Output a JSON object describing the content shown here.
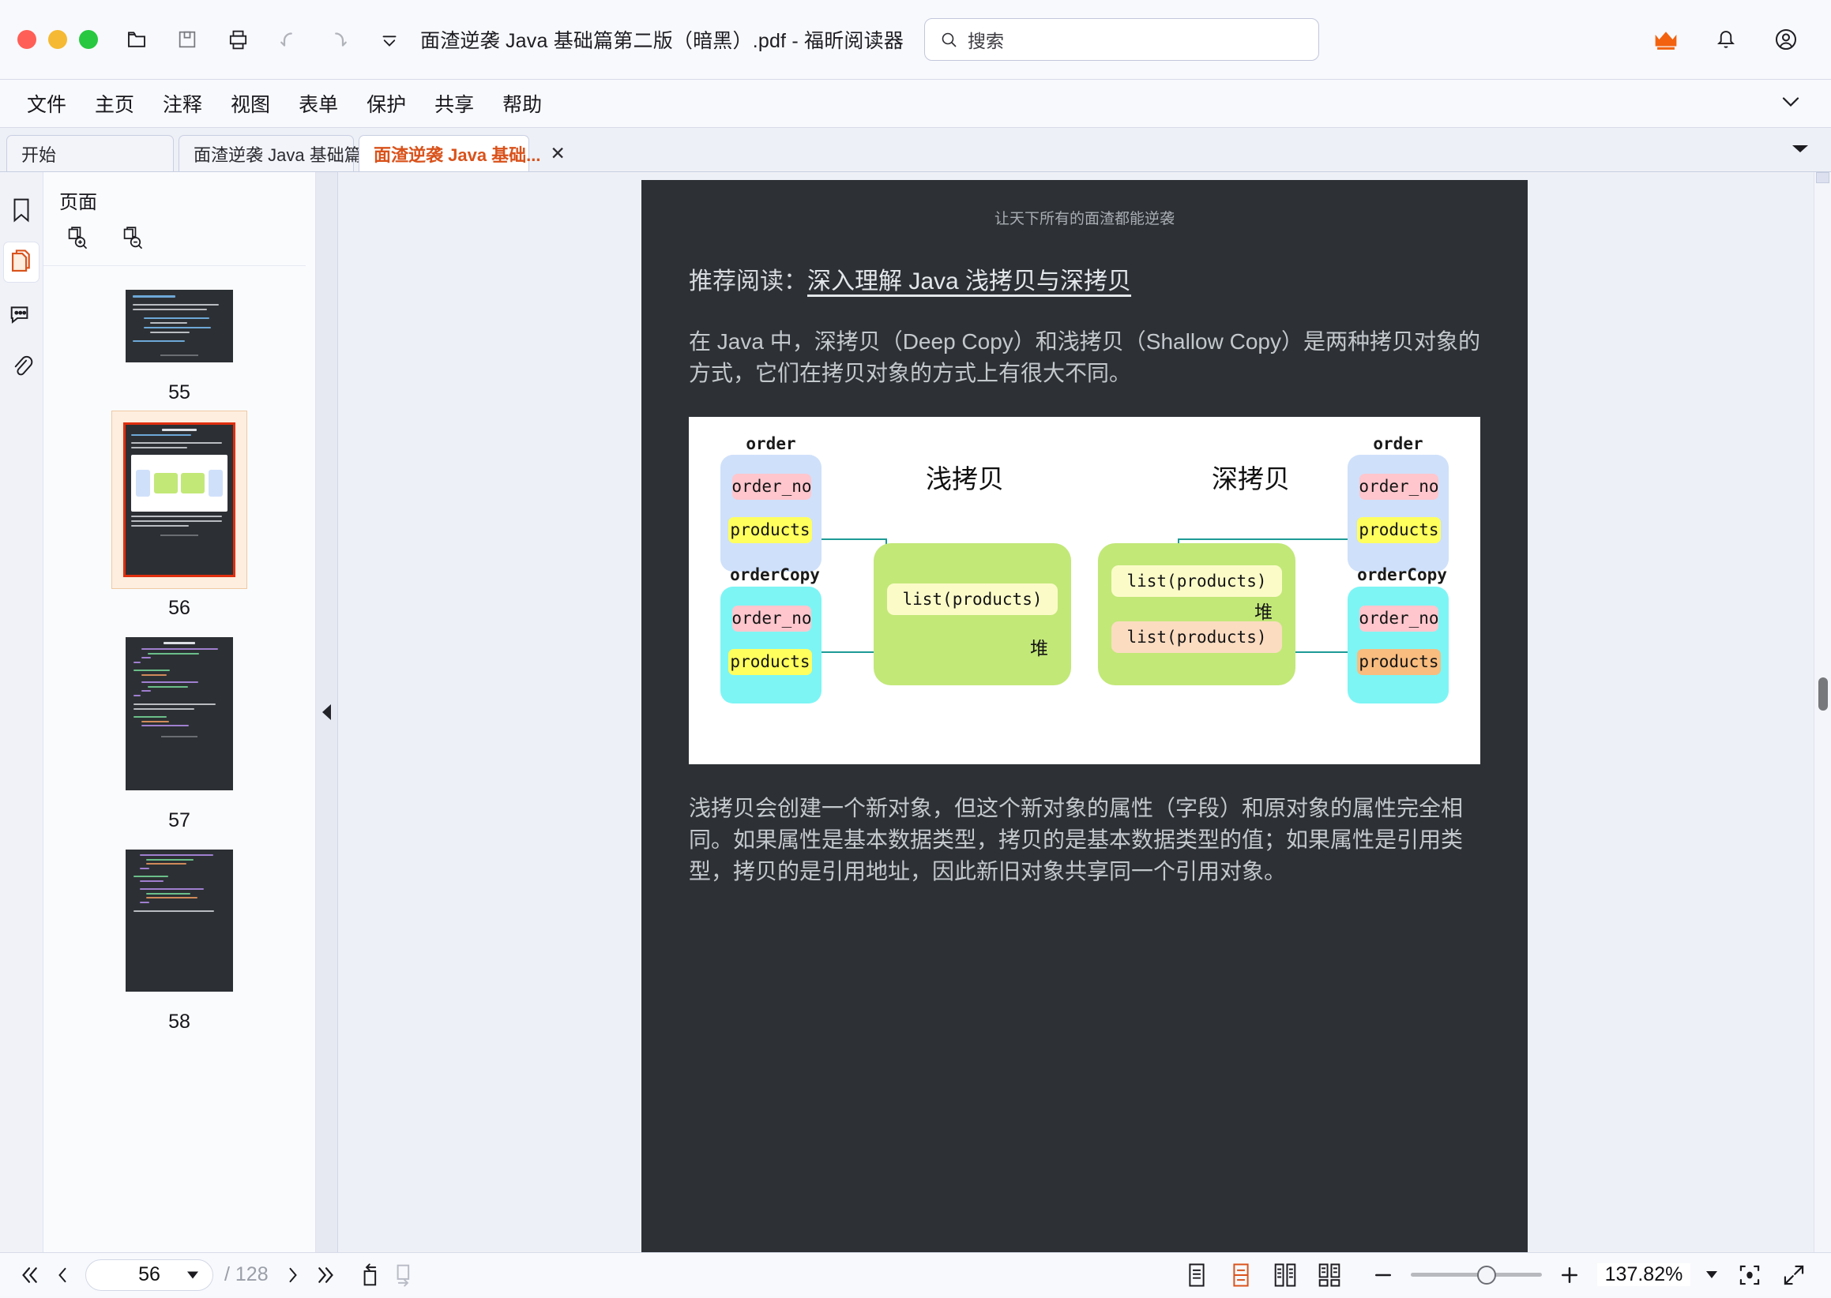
{
  "window": {
    "title": "面渣逆袭 Java 基础篇第二版（暗黑）.pdf - 福昕阅读器",
    "traffic": [
      "close",
      "minimize",
      "maximize"
    ]
  },
  "toolbar": {
    "icons": [
      "open-folder-icon",
      "save-icon",
      "print-icon",
      "undo-icon",
      "redo-icon",
      "customize-toolbar-icon"
    ]
  },
  "search": {
    "placeholder": "搜索",
    "icon": "search-icon"
  },
  "account_bar": {
    "crown": "crown-icon",
    "bell": "bell-icon",
    "avatar": "account-icon",
    "crown_color": "#f2620f"
  },
  "menu": {
    "items": [
      "文件",
      "主页",
      "注释",
      "视图",
      "表单",
      "保护",
      "共享",
      "帮助"
    ],
    "collapse_icon": "chevron-down-icon"
  },
  "tabs": {
    "items": [
      {
        "label": "开始",
        "active": false,
        "closable": false
      },
      {
        "label": "面渣逆袭 Java 基础篇...",
        "active": false,
        "closable": false
      },
      {
        "label": "面渣逆袭 Java 基础...",
        "active": true,
        "closable": true
      }
    ],
    "close_glyph": "✕",
    "overflow_icon": "caret-down-icon",
    "active_color": "#d9521b"
  },
  "rail": {
    "items": [
      {
        "name": "bookmark-icon",
        "active": false
      },
      {
        "name": "pages-icon",
        "active": true
      },
      {
        "name": "comments-icon",
        "active": false
      },
      {
        "name": "attachments-icon",
        "active": false
      }
    ],
    "active_color": "#d9521b"
  },
  "thumbnails_panel": {
    "title": "页面",
    "tools": [
      "zoom-in-thumbnails-icon",
      "zoom-out-thumbnails-icon"
    ],
    "pages": [
      {
        "number": "55",
        "selected": false,
        "kind": "text"
      },
      {
        "number": "56",
        "selected": true,
        "kind": "figure"
      },
      {
        "number": "57",
        "selected": false,
        "kind": "code"
      },
      {
        "number": "58",
        "selected": false,
        "kind": "code"
      }
    ],
    "selected_highlight": "#fdeedf",
    "selected_border": "#e02f0f"
  },
  "collapse_handle": {
    "icon": "collapse-left-triangle-icon"
  },
  "document": {
    "header": "让天下所有的面渣都能逆袭",
    "recommend_prefix": "推荐阅读：",
    "recommend_link": "深入理解 Java 浅拷贝与深拷贝",
    "paragraph_1": "在 Java 中，深拷贝（Deep Copy）和浅拷贝（Shallow Copy）是两种拷贝对象的方式，它们在拷贝对象的方式上有很大不同。",
    "paragraph_2": "浅拷贝会创建一个新对象，但这个新对象的属性（字段）和原对象的属性完全相同。如果属性是基本数据类型，拷贝的是基本数据类型的值；如果属性是引用类型，拷贝的是引用地址，因此新旧对象共享同一个引用对象。",
    "page_bg": "#2d3136"
  },
  "figure": {
    "shallow_title": "浅拷贝",
    "deep_title": "深拷贝",
    "heap_label": "堆",
    "shallow": {
      "order_title": "order",
      "ordercopy_title": "orderCopy",
      "order_fields": [
        "order_no",
        "products"
      ],
      "ordercopy_fields": [
        "order_no",
        "products"
      ],
      "heap_items": [
        "list(products)"
      ]
    },
    "deep": {
      "order_title": "order",
      "ordercopy_title": "orderCopy",
      "order_fields": [
        "order_no",
        "products"
      ],
      "ordercopy_fields": [
        "order_no",
        "products"
      ],
      "heap_items": [
        "list(products)",
        "list(products)"
      ]
    },
    "colors": {
      "order_box": "#cfe0fa",
      "ordercopy_box": "#7df5f5",
      "field_pink": "#ffc6cd",
      "field_yellow": "#ffff5e",
      "field_orange": "#f8bd7f",
      "heap": "#c2e878",
      "heap_item_pale": "#fbfbc8",
      "heap_item_peach": "#fbdcc1",
      "arrow": "#1e9a96"
    }
  },
  "bottombar": {
    "first_page_icon": "double-chevron-left-icon",
    "prev_page_icon": "chevron-left-icon",
    "current_page": "56",
    "page_separator": "/ 128",
    "next_page_icon": "chevron-right-icon",
    "last_page_icon": "double-chevron-right-icon",
    "rotate_left_icon": "rotate-left-icon",
    "rotate_right_icon": "rotate-right-icon",
    "view_modes": [
      {
        "name": "single-page-view-icon",
        "active": false
      },
      {
        "name": "continuous-scroll-view-icon",
        "active": true
      },
      {
        "name": "two-page-view-icon",
        "active": false
      },
      {
        "name": "two-page-continuous-view-icon",
        "active": false
      }
    ],
    "zoom_out_icon": "minus-icon",
    "zoom_in_icon": "plus-icon",
    "zoom_value": "137.82%",
    "zoom_caret_icon": "caret-down-icon",
    "fit_page_icon": "fit-page-icon",
    "fullscreen_icon": "fullscreen-icon",
    "active_color": "#d9521b"
  }
}
